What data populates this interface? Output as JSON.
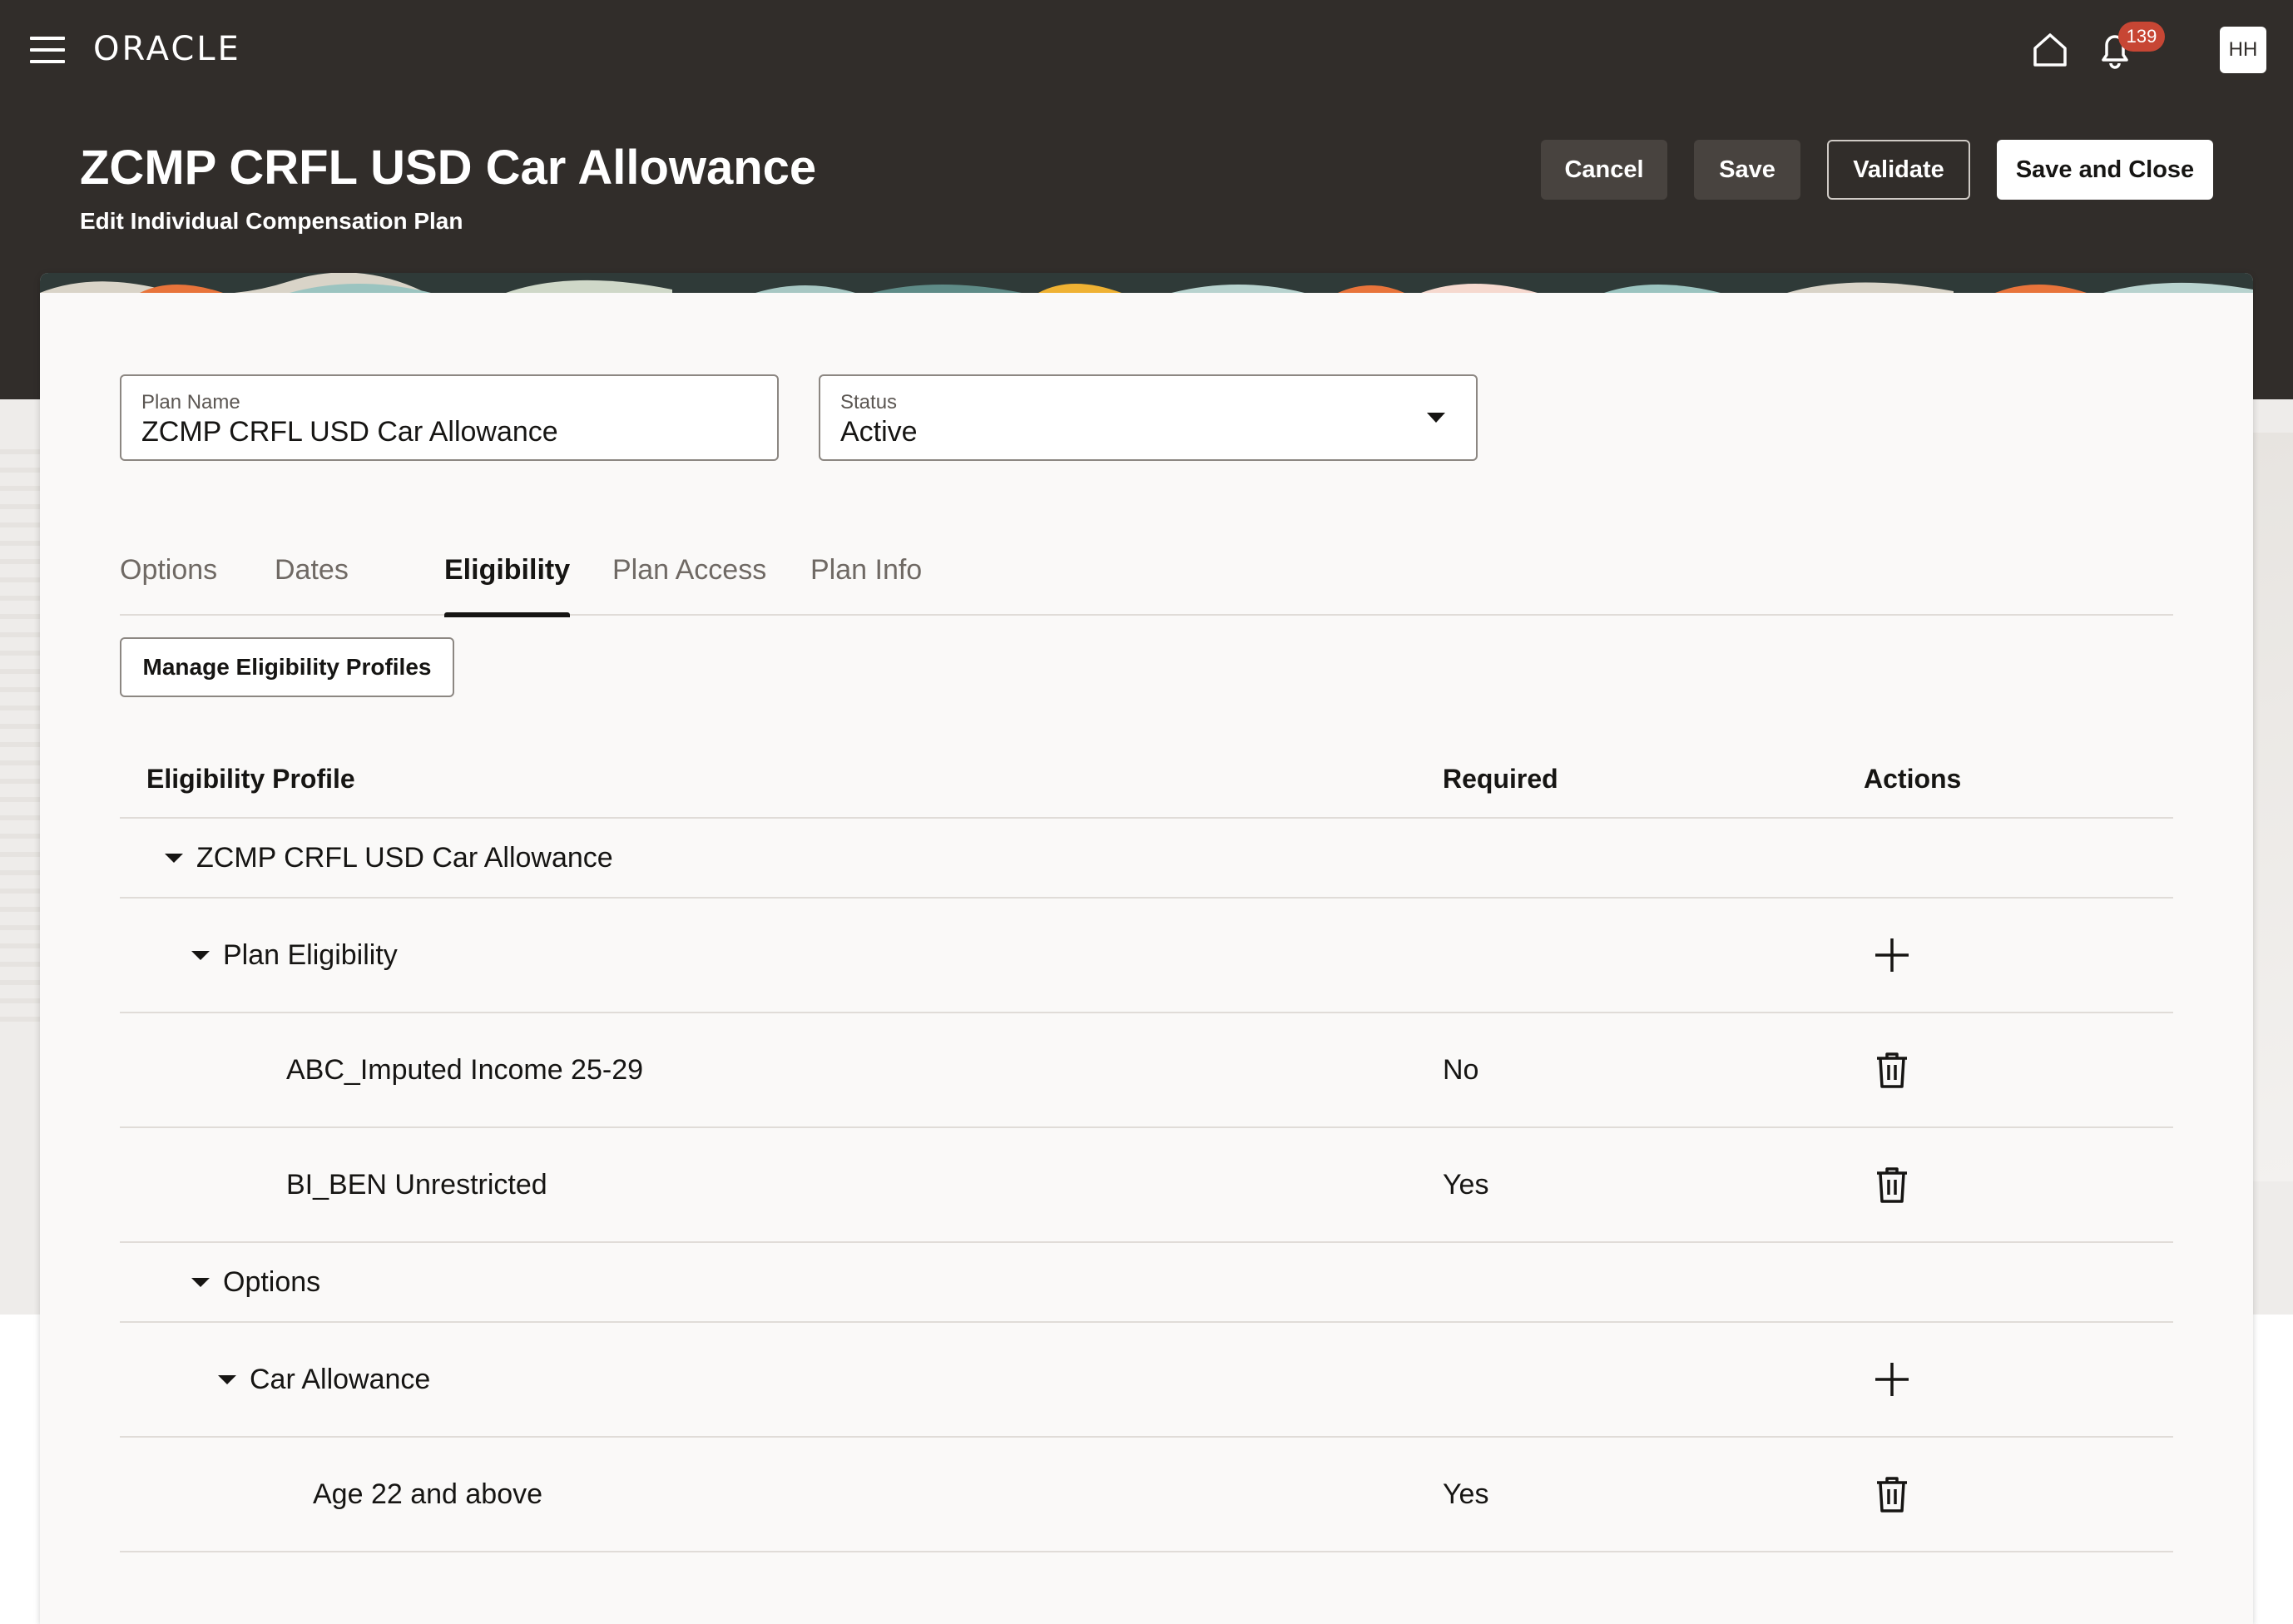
{
  "brand": {
    "logo_text": "ORACLE"
  },
  "topnav": {
    "notification_count": "139",
    "avatar_initials": "HH"
  },
  "header": {
    "title": "ZCMP CRFL USD Car Allowance",
    "subtitle": "Edit Individual Compensation Plan",
    "buttons": {
      "cancel": "Cancel",
      "save": "Save",
      "validate": "Validate",
      "save_close": "Save and Close"
    }
  },
  "form": {
    "plan_name": {
      "label": "Plan Name",
      "value": "ZCMP CRFL USD Car Allowance"
    },
    "status": {
      "label": "Status",
      "value": "Active"
    }
  },
  "tabs": [
    {
      "label": "Options"
    },
    {
      "label": "Dates"
    },
    {
      "label": "Eligibility",
      "active": true
    },
    {
      "label": "Plan Access"
    },
    {
      "label": "Plan Info"
    }
  ],
  "eligibility": {
    "manage_button": "Manage Eligibility Profiles",
    "columns": {
      "profile": "Eligibility Profile",
      "required": "Required",
      "actions": "Actions"
    },
    "rows": [
      {
        "name": "ZCMP CRFL USD Car Allowance",
        "required": "",
        "action": "",
        "expandable": true
      },
      {
        "name": "Plan Eligibility",
        "required": "",
        "action": "add-icon",
        "expandable": true
      },
      {
        "name": "ABC_Imputed Income 25-29",
        "required": "No",
        "action": "delete-icon",
        "expandable": false
      },
      {
        "name": "BI_BEN Unrestricted",
        "required": "Yes",
        "action": "delete-icon",
        "expandable": false
      },
      {
        "name": "Options",
        "required": "",
        "action": "",
        "expandable": true
      },
      {
        "name": "Car Allowance",
        "required": "",
        "action": "add-icon",
        "expandable": true
      },
      {
        "name": "Age 22 and above",
        "required": "Yes",
        "action": "delete-icon",
        "expandable": false
      }
    ]
  },
  "colors": {
    "header_bg": "#312d2a",
    "badge": "#c74634",
    "card_bg": "#faf9f8"
  }
}
